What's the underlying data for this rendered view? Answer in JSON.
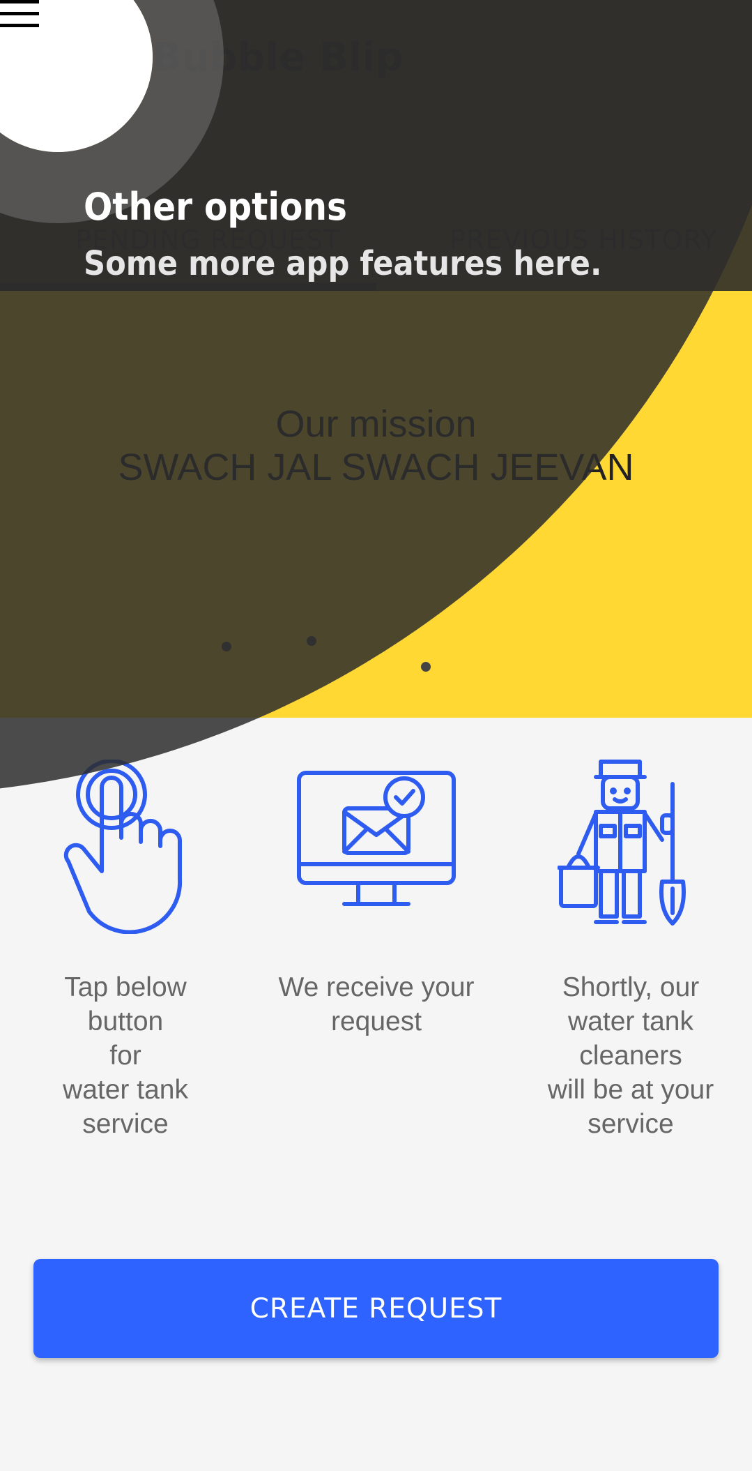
{
  "app": {
    "title": "Bubble Blip",
    "menu_icon": "hamburger-menu-icon"
  },
  "tabs": [
    {
      "label": "PENDING REQUEST",
      "selected": true
    },
    {
      "label": "PREVIOUS HISTORY",
      "selected": false
    }
  ],
  "banner": {
    "title": "Our mission",
    "subtitle": "SWACH JAL SWACH JEEVAN"
  },
  "steps": [
    {
      "icon": "tap-finger-icon",
      "text": "Tap below\nbutton\nfor\nwater tank\nservice"
    },
    {
      "icon": "monitor-mail-check-icon",
      "text": "We receive your\nrequest"
    },
    {
      "icon": "cleaner-worker-icon",
      "text": "Shortly, our\nwater tank\ncleaners\nwill be at your\nservice"
    }
  ],
  "create_button": {
    "label": "CREATE REQUEST"
  },
  "showcase": {
    "title": "Other options",
    "description": "Some more app features here."
  },
  "colors": {
    "primary_yellow": "#ffd834",
    "accent_blue": "#2f63ff",
    "overlay_dark": "#414141"
  }
}
